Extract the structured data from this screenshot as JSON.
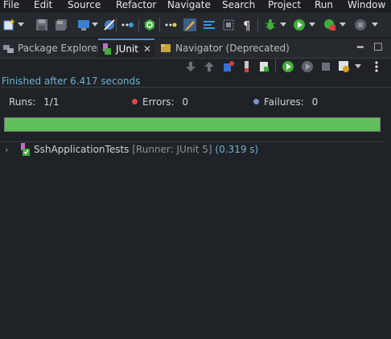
{
  "menu": [
    "File",
    "Edit",
    "Source",
    "Refactor",
    "Navigate",
    "Search",
    "Project",
    "Run",
    "Window"
  ],
  "tabs": {
    "package_explorer": "Package Explorer",
    "junit": "JUnit",
    "navigator": "Navigator (Deprecated)"
  },
  "junit": {
    "status": "Finished after 6.417 seconds",
    "runs_label": "Runs:",
    "runs_value": "1/1",
    "errors_label": "Errors:",
    "errors_value": "0",
    "failures_label": "Failures:",
    "failures_value": "0",
    "progress": 1.0,
    "tree": [
      {
        "name": "SshApplicationTests",
        "runner": "[Runner: JUnit 5]",
        "time": "(0.319 s)"
      }
    ]
  },
  "colors": {
    "progress_green": "#5fbf5a",
    "status_blue": "#6fb3d2",
    "error_red": "#e04848",
    "failure_blue": "#7d92d8"
  }
}
